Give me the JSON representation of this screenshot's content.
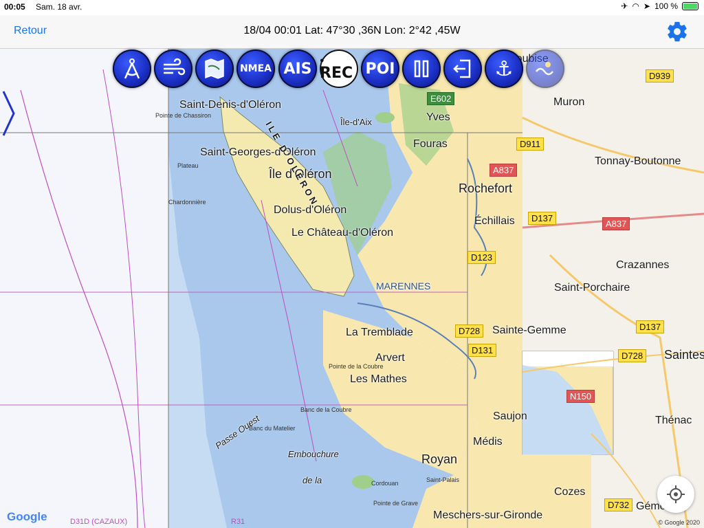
{
  "status_bar": {
    "time": "00:05",
    "date": "Sam. 18 avr.",
    "battery": "100 %"
  },
  "nav": {
    "back_label": "Retour",
    "title": "18/04 00:01  Lat: 47°30 ,36N Lon: 2°42 ,45W"
  },
  "toolbar": {
    "nmea_label": "NMEA",
    "ais_label": "AIS",
    "rec_label": "REC",
    "poi_label": "POI"
  },
  "chart_labels": {
    "saint_denis": "Saint-Denis-d'Oléron",
    "ile_aix": "Île-d'Aix",
    "yves": "Yves",
    "fouras": "Fouras",
    "saint_georges": "Saint-Georges-d'Oléron",
    "ile_oleron": "Île d'Oléron",
    "dolus": "Dolus-d'Oléron",
    "chateau": "Le Château-d'Oléron",
    "rochefort": "Rochefort",
    "echillais": "Échillais",
    "marennes": "MARENNES",
    "la_tremblade": "La Tremblade",
    "arvert": "Arvert",
    "les_mathes": "Les Mathes",
    "royan": "Royan",
    "meschers": "Meschers-sur-Gironde",
    "embouchure": "Embouchure",
    "de_la": "de la",
    "passe_ouest": "Passe Ouest",
    "ile_oleron_vertical": "ILE D'OLÉRON",
    "plateau": "Plateau",
    "chardonniere": "Chardonnière",
    "pointe_chassiron": "Pointe de Chassiron",
    "banc_coubre": "Banc de la Coubre",
    "banc_matelier": "Banc du Matelier",
    "pointe_coubre": "Pointe de la Coubre",
    "cordouan": "Cordouan",
    "pointe_grave": "Pointe de Grave",
    "saint_palais": "Saint-Palais",
    "d31d": "D31D (CAZAUX)",
    "r31": "R31"
  },
  "map_labels": {
    "muron": "Muron",
    "tonnay": "Tonnay-Boutonne",
    "crazannes": "Crazannes",
    "saint_porchaire": "Saint-Porchaire",
    "sainte_gemme": "Sainte-Gemme",
    "saintes": "Saintes",
    "thenac": "Thénac",
    "saujon": "Saujon",
    "medis": "Médis",
    "cozes": "Cozes",
    "gemozac": "Gémozac",
    "soubise": "Soubise"
  },
  "road_shields": {
    "d939": "D939",
    "e602": "E602",
    "d911": "D911",
    "a837a": "A837",
    "a837b": "A837",
    "d137a": "D137",
    "d137b": "D137",
    "d123": "D123",
    "d728a": "D728",
    "d728b": "D728",
    "d131": "D131",
    "n150": "N150",
    "d732": "D732"
  },
  "footer": {
    "google": "Google",
    "copyright": "© Google 2020"
  },
  "colors": {
    "accent": "#1a73e8",
    "deep_water": "#c6dcf2",
    "shallow_water": "#a9c8ec",
    "land": "#f8e8b0",
    "button_blue": "#1b2fc4"
  }
}
